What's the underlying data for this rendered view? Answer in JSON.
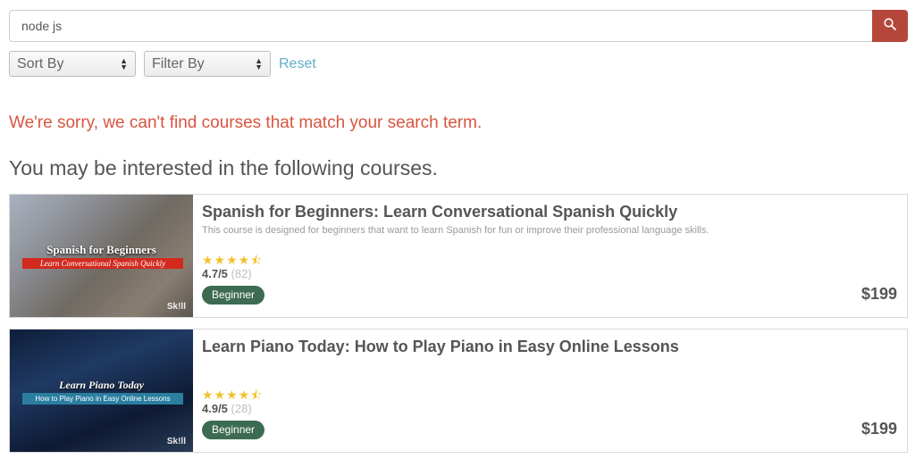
{
  "search": {
    "value": "node js",
    "button_icon": "search-icon"
  },
  "controls": {
    "sort_label": "Sort By",
    "filter_label": "Filter By",
    "reset_label": "Reset"
  },
  "messages": {
    "no_results": "We're sorry, we can't find courses that match your search term.",
    "suggestions_heading": "You may be interested in the following courses."
  },
  "colors": {
    "accent": "#b5473a",
    "error": "#d9543f",
    "link": "#5fb0c7",
    "badge": "#3d6b52",
    "star": "#f2c12e"
  },
  "courses": [
    {
      "title": "Spanish for Beginners: Learn Conversational Spanish Quickly",
      "description": "This course is designed for beginners that want to learn Spanish for fun or improve their professional language skills.",
      "stars": "★★★★⯪",
      "rating": "4.7/5",
      "rating_count": "(82)",
      "level": "Beginner",
      "price": "$199",
      "thumb_title": "Spanish for Beginners",
      "thumb_subtitle": "Learn Conversational Spanish Quickly",
      "thumb_logo": "Sk!ll"
    },
    {
      "title": "Learn Piano Today: How to Play Piano in Easy Online Lessons",
      "description": "",
      "stars": "★★★★⯪",
      "rating": "4.9/5",
      "rating_count": "(28)",
      "level": "Beginner",
      "price": "$199",
      "thumb_title": "Learn Piano Today",
      "thumb_subtitle": "How to Play Piano in Easy Online Lessons",
      "thumb_logo": "Sk!ll"
    }
  ]
}
